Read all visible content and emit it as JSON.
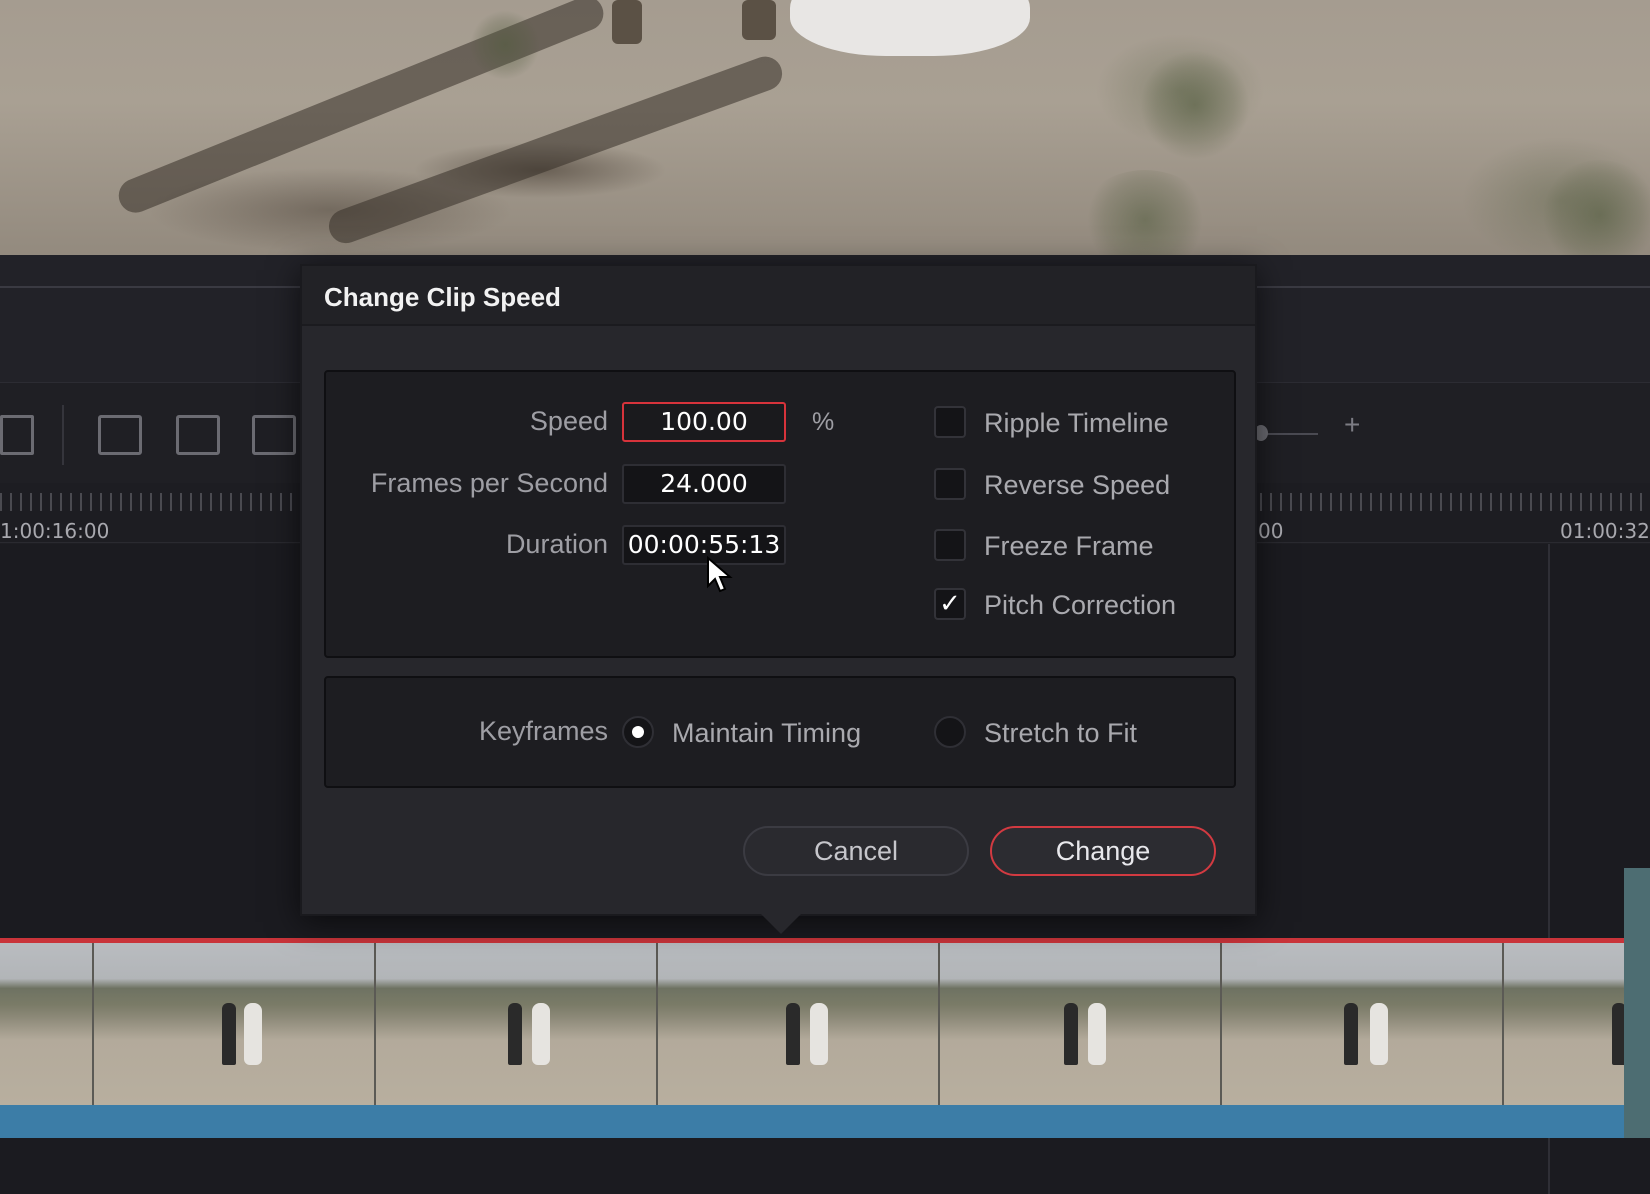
{
  "dialog": {
    "title": "Change Clip Speed",
    "speed_label": "Speed",
    "speed_value": "100.00",
    "speed_unit": "%",
    "fps_label": "Frames per Second",
    "fps_value": "24.000",
    "duration_label": "Duration",
    "duration_value": "00:00:55:13",
    "options": [
      {
        "label": "Ripple Timeline",
        "checked": false
      },
      {
        "label": "Reverse Speed",
        "checked": false
      },
      {
        "label": "Freeze Frame",
        "checked": false
      },
      {
        "label": "Pitch Correction",
        "checked": true,
        "mark": "✓"
      }
    ],
    "keyframes_label": "Keyframes",
    "keyframes_options": [
      {
        "label": "Maintain Timing",
        "selected": true
      },
      {
        "label": "Stretch to Fit",
        "selected": false
      }
    ],
    "cancel_label": "Cancel",
    "change_label": "Change"
  },
  "timeline": {
    "timecode_left": "1:00:16:00",
    "timecode_mid": "00",
    "timecode_right": "01:00:32",
    "zoom_plus": "+"
  },
  "colors": {
    "accent_red": "#d23a41",
    "dialog_bg": "#27272c",
    "field_bg": "#141417",
    "timeline_blue": "#3c7da7"
  },
  "icons": [
    "razor-icon",
    "overwrite-clip-icon",
    "replace-clip-icon",
    "ripple-overwrite-icon",
    "zoom-plus-icon",
    "mouse-pointer-icon",
    "checkmark-icon"
  ]
}
